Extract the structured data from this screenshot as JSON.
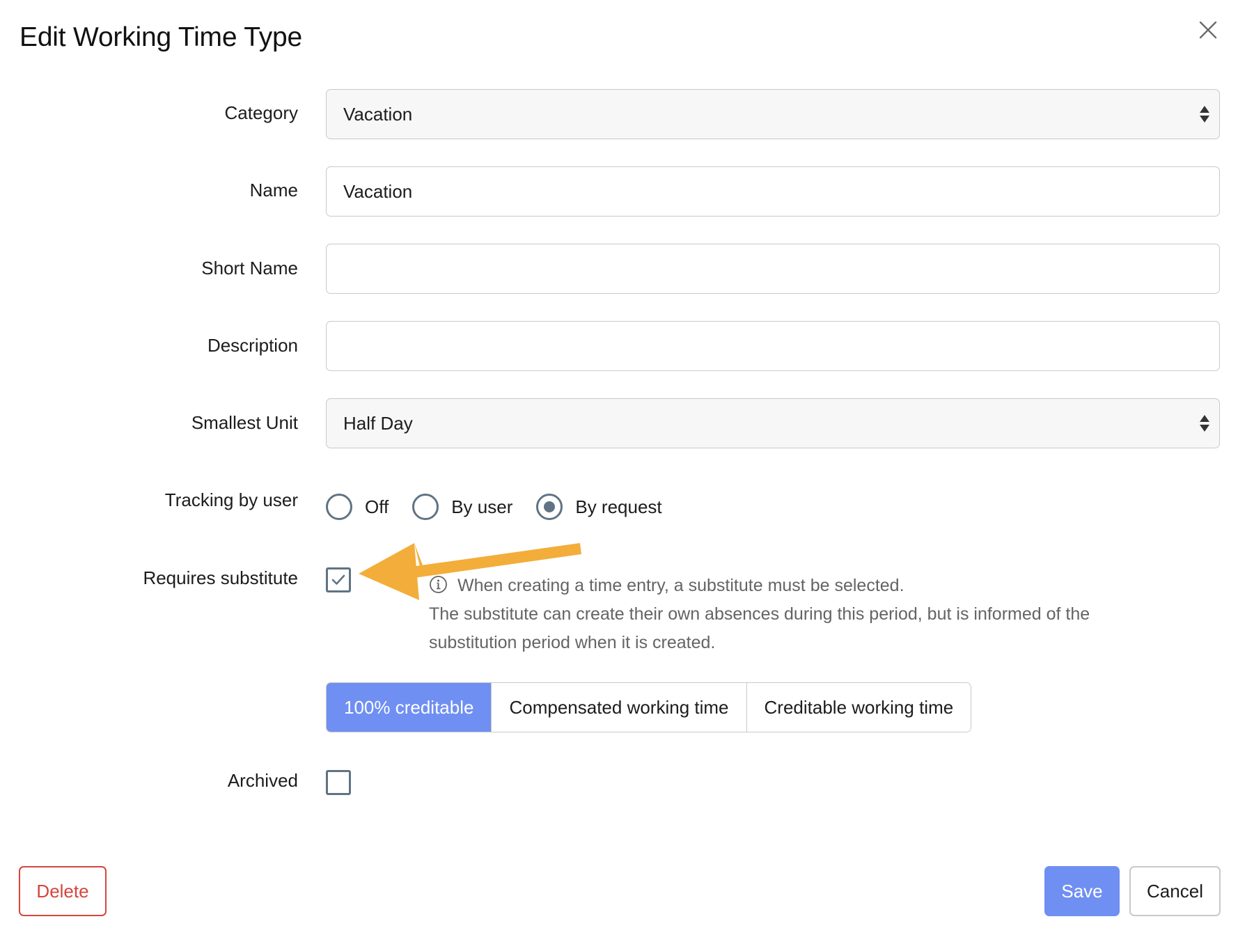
{
  "dialog": {
    "title": "Edit Working Time Type"
  },
  "form": {
    "category": {
      "label": "Category",
      "value": "Vacation"
    },
    "name": {
      "label": "Name",
      "value": "Vacation"
    },
    "short_name": {
      "label": "Short Name",
      "value": ""
    },
    "description": {
      "label": "Description",
      "value": ""
    },
    "smallest_unit": {
      "label": "Smallest Unit",
      "value": "Half Day"
    },
    "tracking": {
      "label": "Tracking by user",
      "options": [
        "Off",
        "By user",
        "By request"
      ],
      "selected": "By request"
    },
    "requires_substitute": {
      "label": "Requires substitute",
      "checked": true,
      "hint_line1": "When creating a time entry, a substitute must be selected.",
      "hint_line2": "The substitute can create their own absences during this period, but is informed of the substitution period when it is created."
    },
    "credit_type": {
      "options": [
        "100% creditable",
        "Compensated working time",
        "Creditable working time"
      ],
      "selected": "100% creditable"
    },
    "archived": {
      "label": "Archived",
      "checked": false
    }
  },
  "actions": {
    "delete_label": "Delete",
    "save_label": "Save",
    "cancel_label": "Cancel"
  },
  "colors": {
    "accent": "#6f8ff2",
    "danger": "#d6453d",
    "annotation_arrow": "#f3ad3b",
    "control_border": "#5f7384"
  },
  "icons": {
    "close": "close-icon",
    "select": "select-arrows-icon",
    "info": "info-icon",
    "check": "check-icon",
    "annotation": "annotation-arrow-icon"
  }
}
